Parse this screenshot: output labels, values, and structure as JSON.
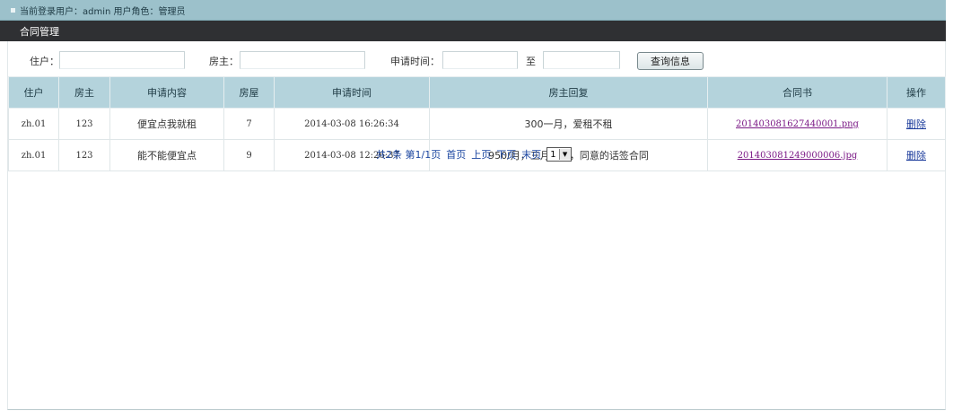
{
  "header": {
    "login_info": "当前登录用户：admin 用户角色：管理员"
  },
  "section": {
    "title": "合同管理"
  },
  "search": {
    "tenant_label": "住户：",
    "tenant_value": "",
    "landlord_label": "房主：",
    "landlord_value": "",
    "date_label": "申请时间：",
    "date_from": "",
    "to_label": "至",
    "date_to": "",
    "button_label": "查询信息"
  },
  "table": {
    "columns": [
      "住户",
      "房主",
      "申请内容",
      "房屋",
      "申请时间",
      "房主回复",
      "合同书",
      "操作"
    ],
    "rows": [
      {
        "tenant": "zh.01",
        "landlord": "123",
        "content": "便宜点我就租",
        "house": "7",
        "time": "2014-03-08 16:26:34",
        "reply": "300一月，爱租不租",
        "contract": "201403081627440001.png",
        "action": "删除"
      },
      {
        "tenant": "zh.01",
        "landlord": "123",
        "content": "能不能便宜点",
        "house": "9",
        "time": "2014-03-08 12:26:37",
        "reply": "950/月，三月起租，同意的话签合同",
        "contract": "201403081249000006.jpg",
        "action": "删除"
      }
    ]
  },
  "pager": {
    "summary": "共2条 第1/1页",
    "first": "首页",
    "prev": "上页",
    "next": "下页",
    "last": "末页",
    "page_value": "1"
  }
}
